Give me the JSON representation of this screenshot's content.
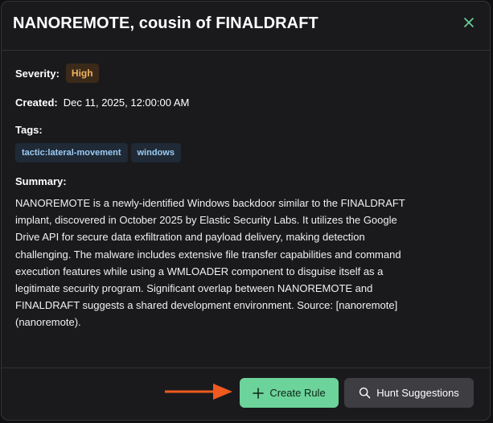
{
  "modal": {
    "title": "NANOREMOTE, cousin of FINALDRAFT",
    "close_icon": "close-icon"
  },
  "details": {
    "severity_label": "Severity:",
    "severity_value": "High",
    "created_label": "Created:",
    "created_value": "Dec 11, 2025, 12:00:00 AM",
    "tags_label": "Tags:",
    "tags": [
      "tactic:lateral-movement",
      "windows"
    ],
    "summary_label": "Summary:",
    "summary_lines": [
      "NANOREMOTE is a newly-identified Windows backdoor similar to the FINALDRAFT",
      "implant, discovered in October 2025 by Elastic Security Labs. It utilizes the Google",
      "Drive API for secure data exfiltration and payload delivery, making detection",
      "challenging. The malware includes extensive file transfer capabilities and command",
      "execution features while using a WMLOADER component to disguise itself as a",
      "legitimate security program. Significant overlap between NANOREMOTE and",
      "FINALDRAFT suggests a shared development environment. Source: [nanoremote]",
      "(nanoremote)."
    ]
  },
  "footer": {
    "create_rule_label": "Create Rule",
    "hunt_suggestions_label": "Hunt Suggestions"
  },
  "colors": {
    "accent_green": "#6cd39a",
    "arrow_orange": "#f05a1e",
    "severity_high": "#f0b45c",
    "tag_text": "#9ccbf4"
  }
}
